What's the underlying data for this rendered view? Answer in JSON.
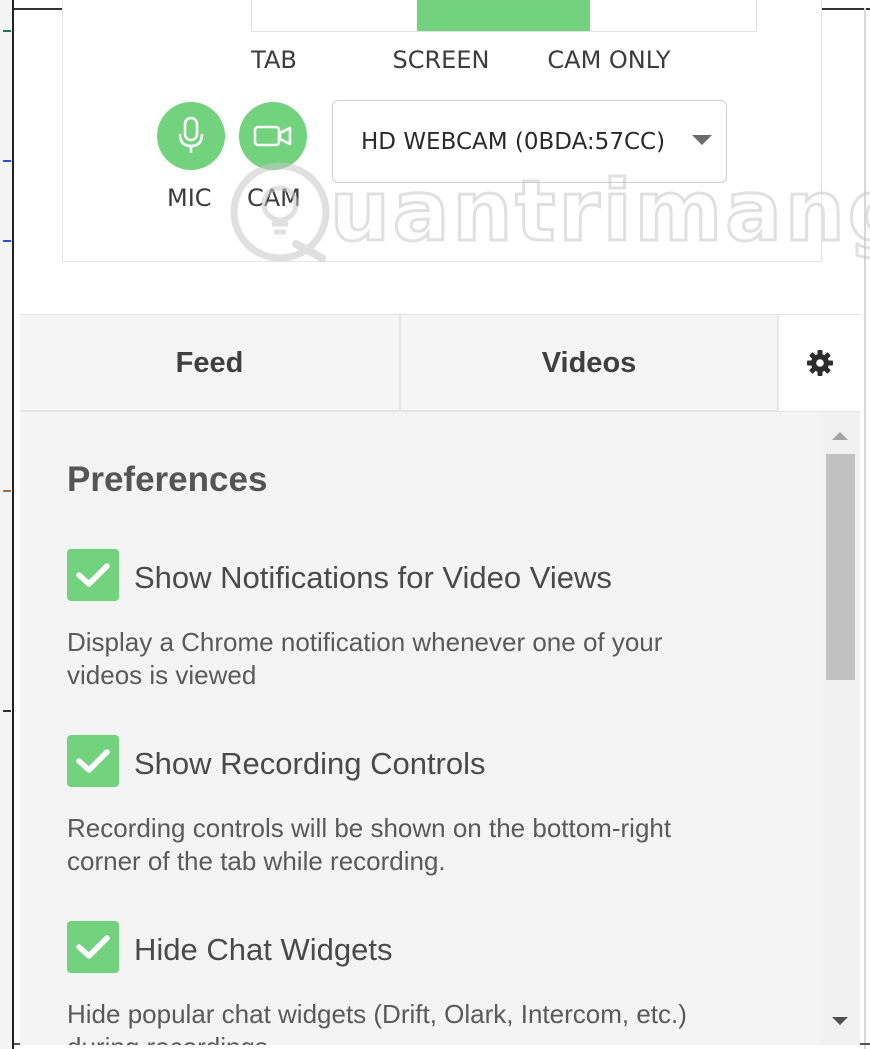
{
  "recording": {
    "modes": [
      {
        "label": "TAB",
        "active": false
      },
      {
        "label": "SCREEN",
        "active": true
      },
      {
        "label": "CAM ONLY",
        "active": false
      }
    ],
    "mic_label": "MIC",
    "cam_label": "CAM",
    "camera_select_value": "HD WEBCAM (0BDA:57CC)"
  },
  "tabs": {
    "feed": "Feed",
    "videos": "Videos",
    "settings_icon": "gear-icon"
  },
  "preferences": {
    "title": "Preferences",
    "items": [
      {
        "label": "Show Notifications for Video Views",
        "desc_line1": "Display a Chrome notification whenever one of your",
        "desc_line2": "videos is viewed",
        "checked": true
      },
      {
        "label": "Show Recording Controls",
        "desc_line1": "Recording controls will be shown on the bottom-right",
        "desc_line2": "corner of the tab while recording.",
        "checked": true
      },
      {
        "label": "Hide Chat Widgets",
        "desc_line1": "Hide popular chat widgets (Drift, Olark, Intercom, etc.)",
        "desc_line2": "during recordings",
        "checked": true
      }
    ]
  },
  "watermark_text": "uantrimang",
  "colors": {
    "accent": "#72d27e",
    "tab_bar": "#f5f5f5",
    "panel_bg": "#f4f4f4"
  }
}
